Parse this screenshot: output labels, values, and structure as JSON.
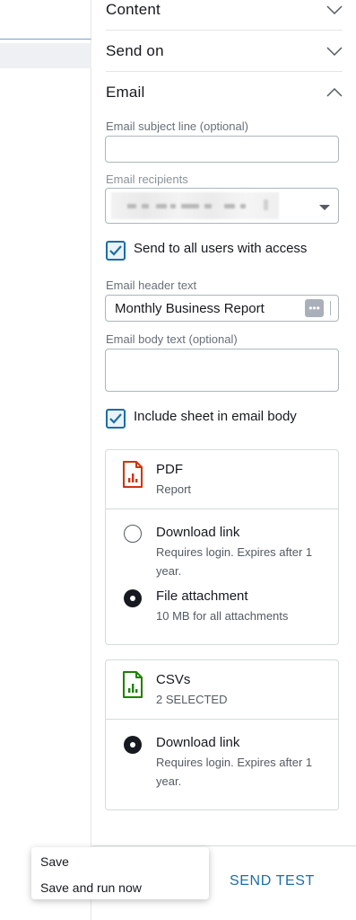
{
  "sections": {
    "content": "Content",
    "send_on": "Send on",
    "email": "Email"
  },
  "email": {
    "subject_label": "Email subject line (optional)",
    "subject_value": "",
    "recipients_label": "Email recipients",
    "send_all_label": "Send to all users with access",
    "send_all_checked": true,
    "header_label": "Email header text",
    "header_value": "Monthly Business Report",
    "header_more": "•••",
    "body_label": "Email body text (optional)",
    "body_value": "",
    "include_sheet_label": "Include sheet in email body",
    "include_sheet_checked": true
  },
  "pdf_card": {
    "title": "PDF",
    "subtitle": "Report",
    "icon": "pdf-file-icon",
    "icon_color": "#d13212",
    "options": [
      {
        "title": "Download link",
        "desc": "Requires login. Expires after 1 year.",
        "selected": false
      },
      {
        "title": "File attachment",
        "desc": "10 MB for all attachments",
        "selected": true
      }
    ]
  },
  "csv_card": {
    "title": "CSVs",
    "subtitle": "2 SELECTED",
    "icon": "csv-file-icon",
    "icon_color": "#1d8102",
    "options": [
      {
        "title": "Download link",
        "desc": "Requires login. Expires after 1 year.",
        "selected": true
      }
    ]
  },
  "footer": {
    "send_test": "SEND TEST"
  },
  "save_menu": {
    "items": [
      "Save",
      "Save and run now"
    ]
  },
  "colors": {
    "accent": "#1b6ea8",
    "text": "#16191f",
    "muted": "#687078"
  }
}
